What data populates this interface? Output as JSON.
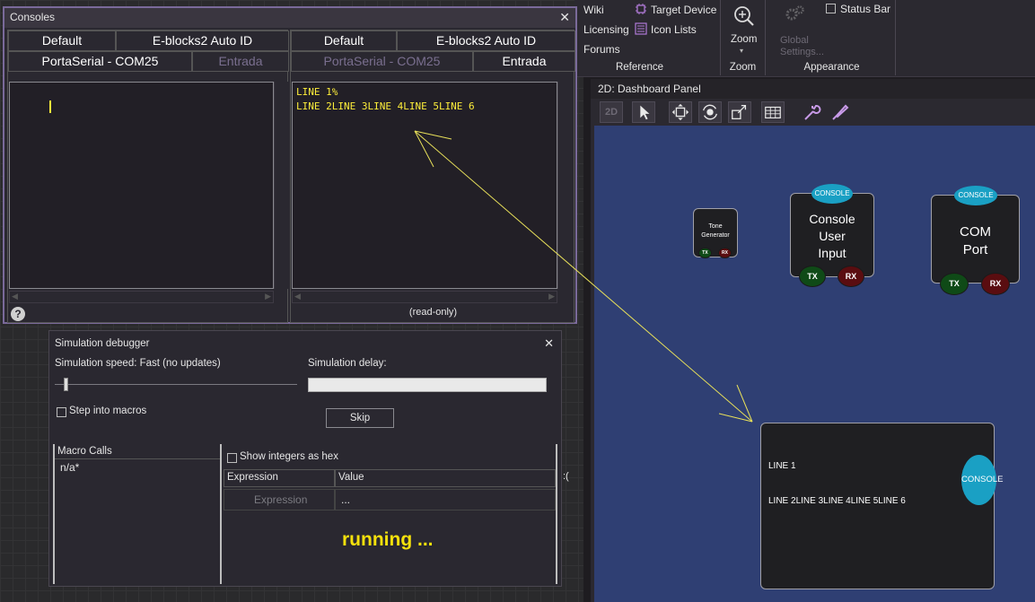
{
  "ribbon": {
    "reference": {
      "wiki": "Wiki",
      "licensing": "Licensing",
      "forums": "Forums",
      "target_device": "Target Device",
      "icon_lists": "Icon Lists",
      "label": "Reference"
    },
    "zoom": {
      "button": "Zoom",
      "label": "Zoom"
    },
    "appearance": {
      "global_settings": "Global Settings...",
      "status_bar": "Status Bar",
      "label": "Appearance"
    }
  },
  "dashboard": {
    "title": "2D: Dashboard Panel",
    "toolbar_2d": "2D",
    "tone_generator": {
      "line1": "Tone",
      "line2": "Generator",
      "tx": "TX",
      "rx": "RX"
    },
    "console_user_input": {
      "badge": "CONSOLE",
      "line1": "Console",
      "line2": "User",
      "line3": "Input",
      "tx": "TX",
      "rx": "RX"
    },
    "com_port": {
      "badge": "CONSOLE",
      "line1": "COM",
      "line2": "Port",
      "tx": "TX",
      "rx": "RX"
    },
    "console_output": {
      "line1": "LINE 1",
      "line2": "LINE 2LINE 3LINE 4LINE 5LINE 6",
      "badge": "CONSOLE"
    }
  },
  "consoles": {
    "title": "Consoles",
    "left": {
      "tab_default": "Default",
      "tab_eblocks": "E-blocks2 Auto ID",
      "tab_porta": "PortaSerial - COM25",
      "tab_entrada": "Entrada"
    },
    "right": {
      "tab_default": "Default",
      "tab_eblocks": "E-blocks2 Auto ID",
      "tab_porta": "PortaSerial - COM25",
      "tab_entrada": "Entrada",
      "line1": "LINE 1%",
      "line2": "LINE 2LINE 3LINE 4LINE 5LINE 6",
      "readonly": "(read-only)"
    },
    "help": "?"
  },
  "simulation_debugger": {
    "title": "Simulation debugger",
    "speed_label": "Simulation speed: Fast (no updates)",
    "delay_label": "Simulation delay:",
    "step_into": "Step into macros",
    "skip": "Skip",
    "macro_calls": "Macro Calls",
    "macro_value": "n/a*",
    "show_hex": "Show integers as hex",
    "col_expression": "Expression",
    "col_value": "Value",
    "row_expression_placeholder": "Expression",
    "row_value": "...",
    "running": "running ...",
    "edge_char": ":("
  },
  "colors": {
    "accent_console": "#1aa0c4",
    "console_text": "#ffef3a",
    "running_text": "#f5e10c",
    "canvas": "#2f3f73"
  }
}
